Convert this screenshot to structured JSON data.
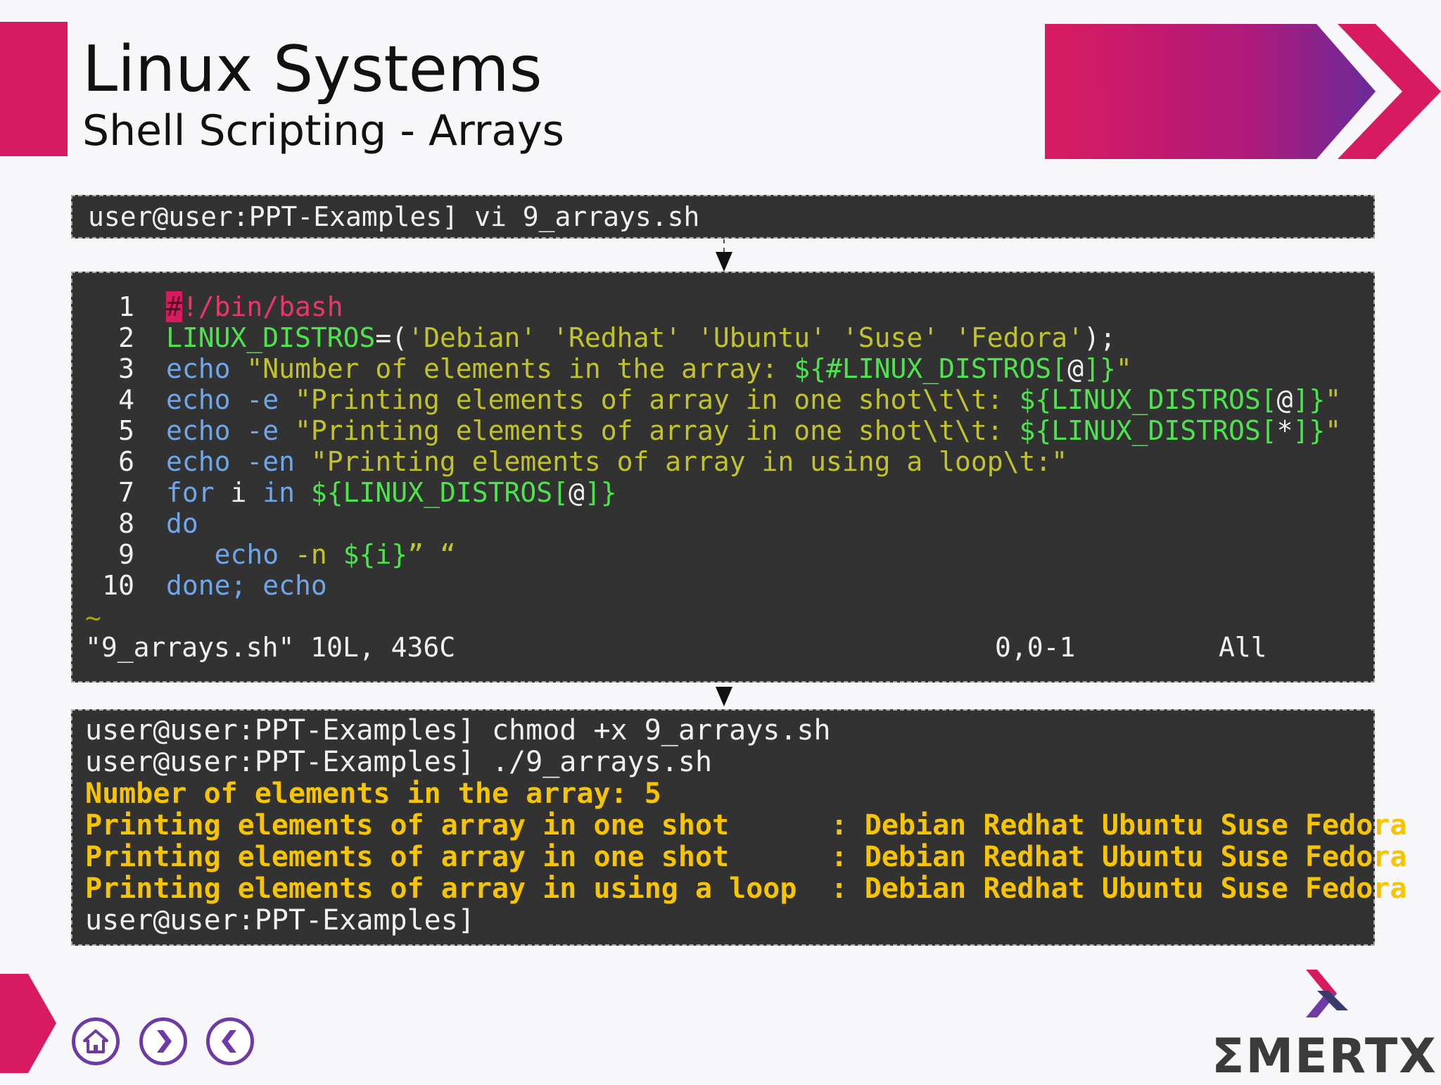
{
  "header": {
    "title": "Linux Systems",
    "subtitle": "Shell Scripting - Arrays"
  },
  "command1": "user@user:PPT-Examples] vi 9_arrays.sh",
  "editor": {
    "line_numbers": [
      "1",
      "2",
      "3",
      "4",
      "5",
      "6",
      "7",
      "8",
      "9",
      "10"
    ],
    "lines": [
      [
        {
          "t": "#",
          "c": "c-hash"
        },
        {
          "t": "!/bin/bash",
          "c": "c-red"
        }
      ],
      [
        {
          "t": "LINUX_DISTROS",
          "c": "c-green"
        },
        {
          "t": "=(",
          "c": "c-white"
        },
        {
          "t": "'Debian' 'Redhat' 'Ubuntu' 'Suse' 'Fedora'",
          "c": "c-olive"
        },
        {
          "t": ");",
          "c": "c-white"
        }
      ],
      [
        {
          "t": "echo ",
          "c": "c-blue"
        },
        {
          "t": "\"Number of elements in the array: ",
          "c": "c-olive"
        },
        {
          "t": "${#LINUX_DISTROS[",
          "c": "c-green"
        },
        {
          "t": "@",
          "c": "c-white"
        },
        {
          "t": "]}",
          "c": "c-green"
        },
        {
          "t": "\"",
          "c": "c-olive"
        }
      ],
      [
        {
          "t": "echo ",
          "c": "c-blue"
        },
        {
          "t": "-e ",
          "c": "c-blue"
        },
        {
          "t": "\"Printing elements of array in one shot\\t\\t: ",
          "c": "c-olive"
        },
        {
          "t": "${LINUX_DISTROS[",
          "c": "c-green"
        },
        {
          "t": "@",
          "c": "c-white"
        },
        {
          "t": "]}",
          "c": "c-green"
        },
        {
          "t": "\"",
          "c": "c-olive"
        }
      ],
      [
        {
          "t": "echo ",
          "c": "c-blue"
        },
        {
          "t": "-e ",
          "c": "c-blue"
        },
        {
          "t": "\"Printing elements of array in one shot\\t\\t: ",
          "c": "c-olive"
        },
        {
          "t": "${LINUX_DISTROS[",
          "c": "c-green"
        },
        {
          "t": "*",
          "c": "c-white"
        },
        {
          "t": "]}",
          "c": "c-green"
        },
        {
          "t": "\"",
          "c": "c-olive"
        }
      ],
      [
        {
          "t": "echo ",
          "c": "c-blue"
        },
        {
          "t": "-en ",
          "c": "c-blue"
        },
        {
          "t": "\"Printing elements of array in using a loop\\t:\"",
          "c": "c-olive"
        }
      ],
      [
        {
          "t": "for ",
          "c": "c-blue"
        },
        {
          "t": "i ",
          "c": "c-white"
        },
        {
          "t": "in ",
          "c": "c-blue"
        },
        {
          "t": "${LINUX_DISTROS[",
          "c": "c-green"
        },
        {
          "t": "@",
          "c": "c-white"
        },
        {
          "t": "]}",
          "c": "c-green"
        }
      ],
      [
        {
          "t": "do",
          "c": "c-blue"
        }
      ],
      [
        {
          "t": "   echo ",
          "c": "c-blue"
        },
        {
          "t": "-n ",
          "c": "c-olive"
        },
        {
          "t": "${i}",
          "c": "c-green"
        },
        {
          "t": "” “",
          "c": "c-olive"
        }
      ],
      [
        {
          "t": "done; echo",
          "c": "c-blue"
        }
      ]
    ],
    "tilde": "~",
    "status_file": "\"9_arrays.sh\" 10L, 436C",
    "status_pos": "0,0-1",
    "status_all": "All"
  },
  "output": {
    "lines": [
      {
        "text": "user@user:PPT-Examples] chmod +x 9_arrays.sh",
        "style": "plain"
      },
      {
        "text": "user@user:PPT-Examples] ./9_arrays.sh",
        "style": "plain"
      },
      {
        "text": "Number of elements in the array: 5",
        "style": "yellow"
      },
      {
        "text": "Printing elements of array in one shot      : Debian Redhat Ubuntu Suse Fedora",
        "style": "yellow"
      },
      {
        "text": "Printing elements of array in one shot      : Debian Redhat Ubuntu Suse Fedora",
        "style": "yellow"
      },
      {
        "text": "Printing elements of array in using a loop  : Debian Redhat Ubuntu Suse Fedora",
        "style": "yellow"
      },
      {
        "text": "user@user:PPT-Examples]",
        "style": "plain"
      }
    ]
  },
  "footer": {
    "nav": [
      {
        "name": "home-button",
        "icon": "home-icon"
      },
      {
        "name": "next-button",
        "icon": "chevron-right-icon"
      },
      {
        "name": "previous-button",
        "icon": "chevron-left-icon"
      }
    ],
    "logo_text": "ΣMERTXE"
  },
  "colors": {
    "accent": "#d81b60",
    "purple": "#6d3aa6",
    "terminal_bg": "#323232",
    "output_yellow": "#f6c400"
  }
}
